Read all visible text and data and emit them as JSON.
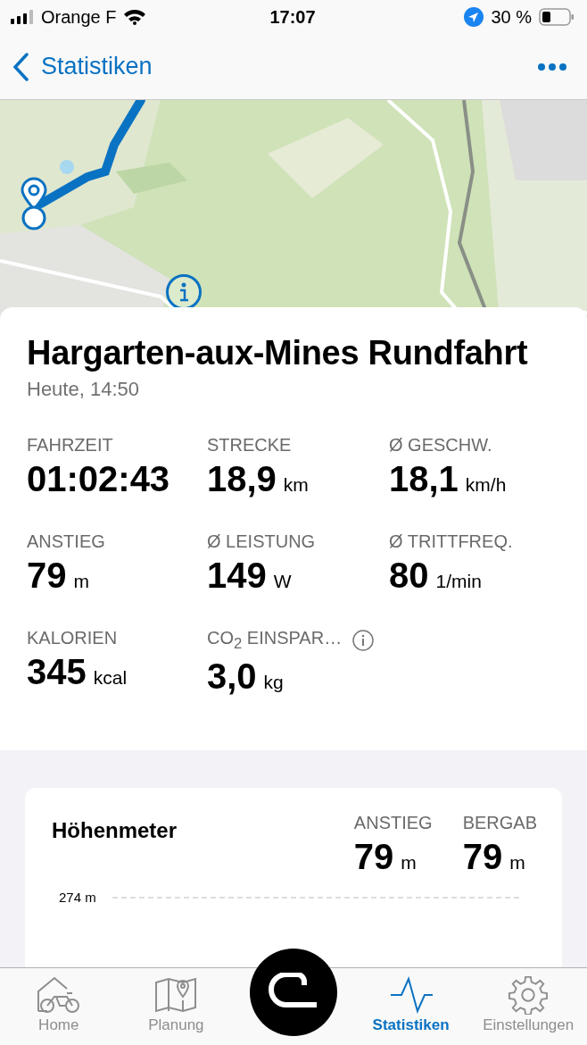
{
  "status_bar": {
    "carrier": "Orange F",
    "time": "17:07",
    "battery": "30 %"
  },
  "nav": {
    "back_label": "Statistiken"
  },
  "ride": {
    "title": "Hargarten-aux-Mines Rundfahrt",
    "date": "Heute, 14:50"
  },
  "stats": [
    {
      "label": "FAHRZEIT",
      "value": "01:02:43",
      "info": false
    },
    {
      "label": "STRECKE",
      "value": "18,9",
      "unit": "km",
      "info": false
    },
    {
      "label": "Ø GESCHW.",
      "value": "18,1",
      "unit": "km/h",
      "info": false
    },
    {
      "label": "ANSTIEG",
      "value": "79",
      "unit": "m",
      "info": false
    },
    {
      "label": "Ø LEISTUNG",
      "value": "149",
      "unit": "W",
      "info": false
    },
    {
      "label": "Ø TRITTFREQ.",
      "value": "80",
      "unit": "1/min",
      "info": false
    },
    {
      "label": "KALORIEN",
      "value": "345",
      "unit": "kcal",
      "info": false
    },
    {
      "label": "CO$_{2}$ EINSPAR…",
      "value": "3,0",
      "unit": "kg",
      "info": true
    }
  ],
  "elevation": {
    "title": "Höhenmeter",
    "summary": [
      {
        "label": "ANSTIEG",
        "value": "79",
        "unit": "m"
      },
      {
        "label": "BERGAB",
        "value": "79",
        "unit": "m"
      }
    ],
    "top_tick": "274 m"
  },
  "tab_bar": [
    {
      "kind": "home",
      "label": "Home",
      "selected": false
    },
    {
      "kind": "planning",
      "label": "Planung",
      "selected": false
    },
    {
      "kind": "record",
      "selected": false
    },
    {
      "kind": "stats",
      "label": "Statistiken",
      "selected": true
    },
    {
      "kind": "settings",
      "label": "Einstellungen",
      "selected": false
    }
  ]
}
